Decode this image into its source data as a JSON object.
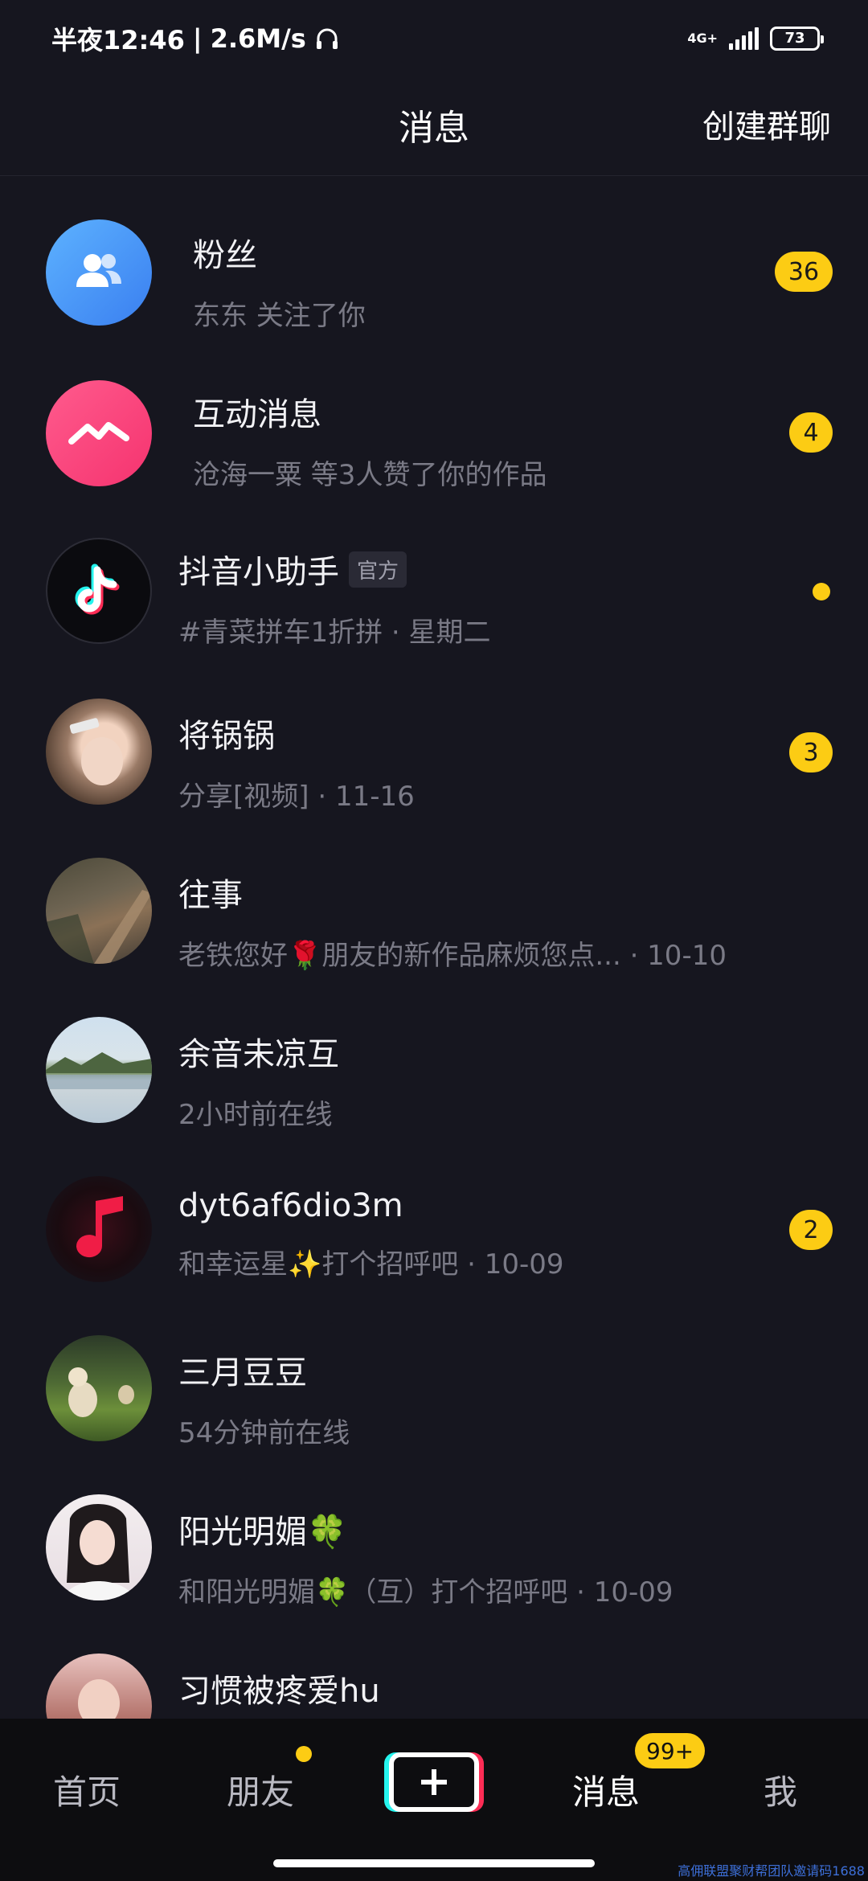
{
  "status_bar": {
    "time": "半夜12:46",
    "speed": "2.6M/s",
    "network": "4G+",
    "battery": "73"
  },
  "header": {
    "title": "消息",
    "action": "创建群聊"
  },
  "conversations": [
    {
      "name": "粉丝",
      "preview": "东东 关注了你",
      "badge": "36",
      "avatar_icon": "fans-icon"
    },
    {
      "name": "互动消息",
      "preview": "沧海一粟 等3人赞了你的作品",
      "badge": "4",
      "avatar_icon": "interaction-icon"
    },
    {
      "name": "抖音小助手",
      "tag": "官方",
      "preview": "#青菜拼车1折拼 · 星期二",
      "dot": true,
      "avatar_icon": "tiktok-logo-icon"
    },
    {
      "name": "将锅锅",
      "preview": "分享[视频] · 11-16",
      "badge": "3",
      "avatar_icon": "user-avatar"
    },
    {
      "name": "往事",
      "preview": "老铁您好🌹朋友的新作品麻烦您点... · 10-10",
      "avatar_icon": "user-avatar"
    },
    {
      "name": "余音未凉互",
      "preview": "2小时前在线",
      "avatar_icon": "user-avatar"
    },
    {
      "name": "dyt6af6dio3m",
      "preview": "和幸运星✨打个招呼吧 · 10-09",
      "badge": "2",
      "avatar_icon": "music-note-icon"
    },
    {
      "name": "三月豆豆",
      "preview": "54分钟前在线",
      "avatar_icon": "user-avatar"
    },
    {
      "name": "阳光明媚🍀",
      "preview": "和阳光明媚🍀（互）打个招呼吧 · 10-09",
      "avatar_icon": "user-avatar"
    },
    {
      "name": "习惯被疼爱hu",
      "preview": "",
      "avatar_icon": "user-avatar"
    }
  ],
  "bottom_nav": {
    "home": "首页",
    "friends": "朋友",
    "messages": "消息",
    "messages_badge": "99+",
    "me": "我"
  },
  "watermark": "高佣联盟聚财帮团队邀请码1688"
}
